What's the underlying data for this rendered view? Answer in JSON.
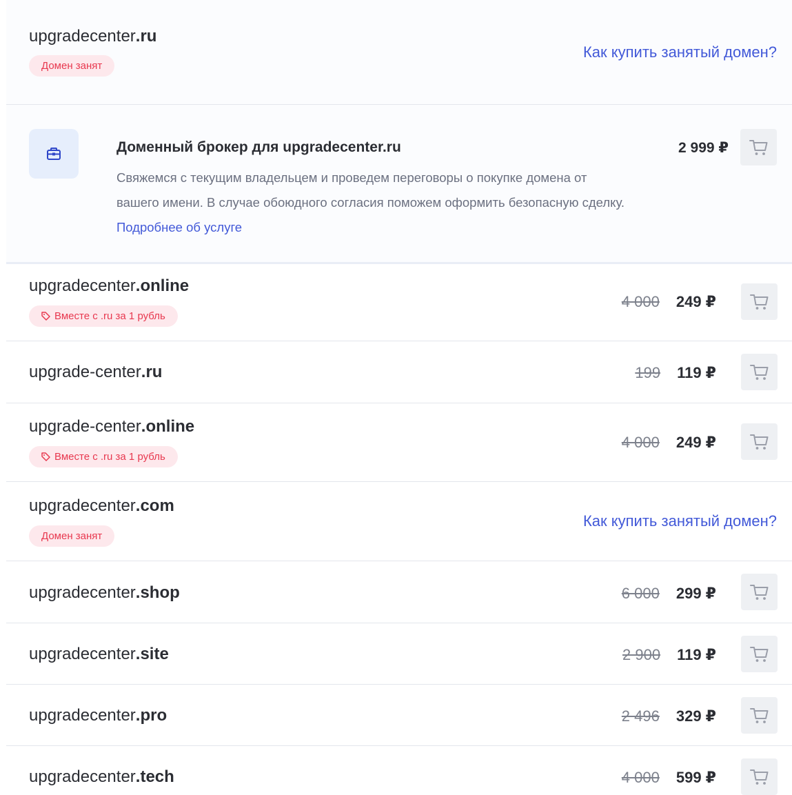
{
  "taken_header": {
    "domain_base": "upgradecenter",
    "domain_tld": ".ru",
    "badge": "Домен занят",
    "how_link": "Как купить занятый домен?"
  },
  "broker": {
    "icon": "briefcase-icon",
    "title": "Доменный брокер для upgradecenter.ru",
    "description": "Свяжемся с текущим владельцем и проведем переговоры о покупке домена от вашего имени. В случае обоюдного согласия поможем оформить безопасную сделку.",
    "more_link": "Подробнее об услуге",
    "price": "2 999 ₽"
  },
  "rows": [
    {
      "base": "upgradecenter",
      "tld": ".online",
      "old_price": "4 000",
      "price": "249 ₽",
      "promo": "Вместе с .ru за 1 рубль"
    },
    {
      "base": "upgrade-center",
      "tld": ".ru",
      "old_price": "199",
      "price": "119 ₽"
    },
    {
      "base": "upgrade-center",
      "tld": ".online",
      "old_price": "4 000",
      "price": "249 ₽",
      "promo": "Вместе с .ru за 1 рубль"
    },
    {
      "base": "upgradecenter",
      "tld": ".com",
      "taken_badge": "Домен занят",
      "how_link": "Как купить занятый домен?"
    },
    {
      "base": "upgradecenter",
      "tld": ".shop",
      "old_price": "6 000",
      "price": "299 ₽"
    },
    {
      "base": "upgradecenter",
      "tld": ".site",
      "old_price": "2 900",
      "price": "119 ₽"
    },
    {
      "base": "upgradecenter",
      "tld": ".pro",
      "old_price": "2 496",
      "price": "329 ₽"
    },
    {
      "base": "upgradecenter",
      "tld": ".tech",
      "old_price": "4 000",
      "price": "599 ₽"
    }
  ],
  "colors": {
    "accent_link": "#4259d8",
    "badge_bg": "#fde8ec",
    "badge_text": "#e8384f",
    "cart_bg": "#eef0f3",
    "broker_icon_bg": "#e6eefc"
  },
  "icons": {
    "cart": "shopping-cart-icon",
    "promo": "tag-icon"
  }
}
